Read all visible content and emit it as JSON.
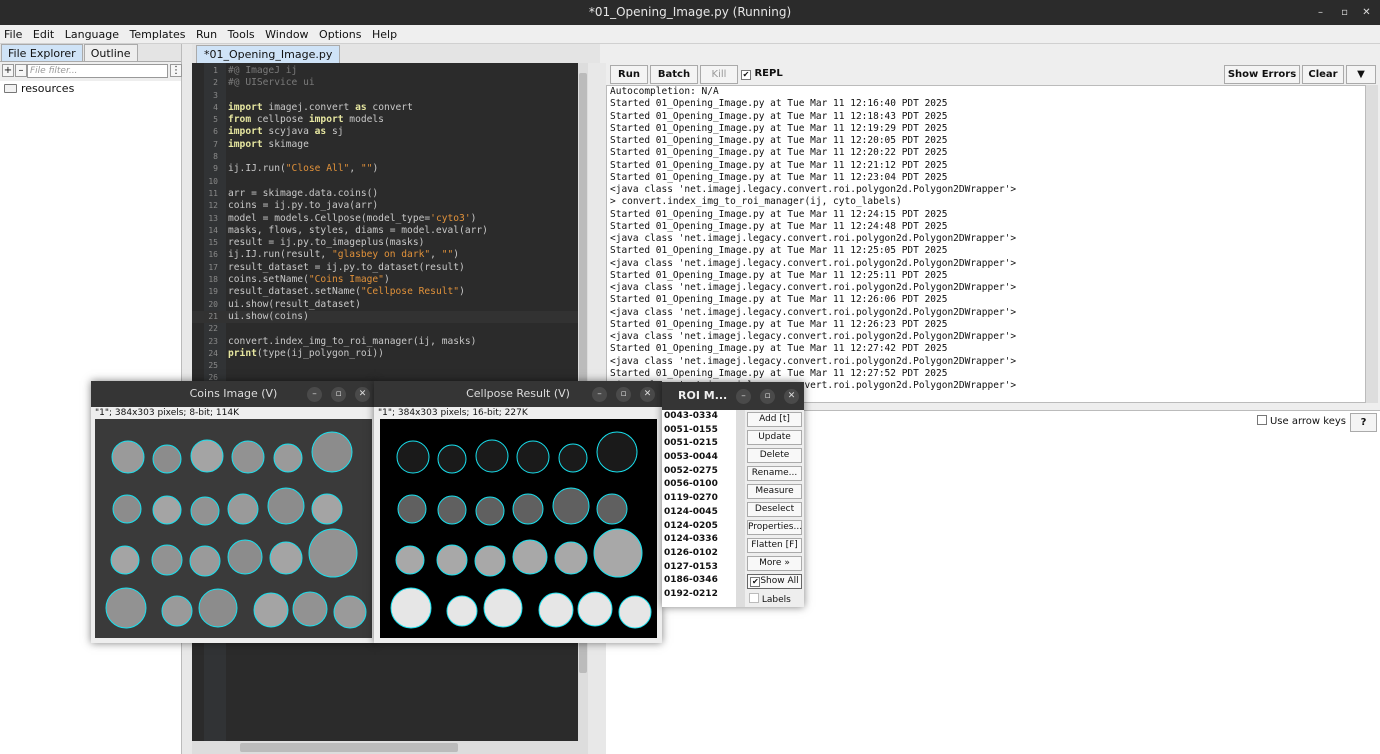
{
  "window": {
    "title": "*01_Opening_Image.py (Running)",
    "controls": [
      "–",
      "▫",
      "✕"
    ]
  },
  "menu": [
    "File",
    "Edit",
    "Language",
    "Templates",
    "Run",
    "Tools",
    "Window",
    "Options",
    "Help"
  ],
  "left_tabs": [
    "File Explorer",
    "Outline"
  ],
  "filter": {
    "placeholder": "File filter...",
    "buttons": [
      "+",
      "–",
      "⋮"
    ]
  },
  "tree": [
    "resources"
  ],
  "editor_tab": "*01_Opening_Image.py",
  "code_lines": [
    [
      {
        "t": "#@ ImageJ ij",
        "c": "cm"
      }
    ],
    [
      {
        "t": "#@ UIService ui",
        "c": "cm"
      }
    ],
    [],
    [
      {
        "t": "import",
        "c": "kw"
      },
      {
        "t": " imagej.convert "
      },
      {
        "t": "as",
        "c": "kw"
      },
      {
        "t": " convert"
      }
    ],
    [
      {
        "t": "from",
        "c": "kw"
      },
      {
        "t": " cellpose "
      },
      {
        "t": "import",
        "c": "kw"
      },
      {
        "t": " models"
      }
    ],
    [
      {
        "t": "import",
        "c": "kw"
      },
      {
        "t": " scyjava "
      },
      {
        "t": "as",
        "c": "kw"
      },
      {
        "t": " sj"
      }
    ],
    [
      {
        "t": "import",
        "c": "kw"
      },
      {
        "t": " skimage"
      }
    ],
    [],
    [
      {
        "t": "ij.IJ.run("
      },
      {
        "t": "\"Close All\"",
        "c": "str"
      },
      {
        "t": ", "
      },
      {
        "t": "\"\"",
        "c": "str"
      },
      {
        "t": ")"
      }
    ],
    [],
    [
      {
        "t": "arr = skimage.data.coins()"
      }
    ],
    [
      {
        "t": "coins = ij.py.to_java(arr)"
      }
    ],
    [
      {
        "t": "model = models.Cellpose(model_type="
      },
      {
        "t": "'cyto3'",
        "c": "str"
      },
      {
        "t": ")"
      }
    ],
    [
      {
        "t": "masks, flows, styles, diams = model.eval(arr)"
      }
    ],
    [
      {
        "t": "result = ij.py.to_imageplus(masks)"
      }
    ],
    [
      {
        "t": "ij.IJ.run(result, "
      },
      {
        "t": "\"glasbey on dark\"",
        "c": "str"
      },
      {
        "t": ", "
      },
      {
        "t": "\"\"",
        "c": "str"
      },
      {
        "t": ")"
      }
    ],
    [
      {
        "t": "result_dataset = ij.py.to_dataset(result)"
      }
    ],
    [
      {
        "t": "coins.setName("
      },
      {
        "t": "\"Coins Image\"",
        "c": "str"
      },
      {
        "t": ")"
      }
    ],
    [
      {
        "t": "result_dataset.setName("
      },
      {
        "t": "\"Cellpose Result\"",
        "c": "str"
      },
      {
        "t": ")"
      }
    ],
    [
      {
        "t": "ui.show(result_dataset)"
      }
    ],
    [
      {
        "t": "ui.show(coins)"
      }
    ],
    [],
    [
      {
        "t": "convert.index_img_to_roi_manager(ij, masks)"
      }
    ],
    [
      {
        "t": "print",
        "c": "kw"
      },
      {
        "t": "(type(ij_polygon_roi))"
      }
    ],
    [],
    []
  ],
  "current_line": 21,
  "toolbar": {
    "run": "Run",
    "batch": "Batch",
    "kill": "Kill",
    "repl": "REPL",
    "show_errors": "Show Errors",
    "clear": "Clear",
    "menu": "▼"
  },
  "console_lines": [
    "Autocompletion: N/A",
    "Started 01_Opening_Image.py at Tue Mar 11 12:16:40 PDT 2025",
    "Started 01_Opening_Image.py at Tue Mar 11 12:18:43 PDT 2025",
    "Started 01_Opening_Image.py at Tue Mar 11 12:19:29 PDT 2025",
    "Started 01_Opening_Image.py at Tue Mar 11 12:20:05 PDT 2025",
    "Started 01_Opening_Image.py at Tue Mar 11 12:20:22 PDT 2025",
    "Started 01_Opening_Image.py at Tue Mar 11 12:21:12 PDT 2025",
    "Started 01_Opening_Image.py at Tue Mar 11 12:23:04 PDT 2025",
    "<java class 'net.imagej.legacy.convert.roi.polygon2d.Polygon2DWrapper'>",
    "> convert.index_img_to_roi_manager(ij, cyto_labels)",
    "Started 01_Opening_Image.py at Tue Mar 11 12:24:15 PDT 2025",
    "Started 01_Opening_Image.py at Tue Mar 11 12:24:48 PDT 2025",
    "<java class 'net.imagej.legacy.convert.roi.polygon2d.Polygon2DWrapper'>",
    "Started 01_Opening_Image.py at Tue Mar 11 12:25:05 PDT 2025",
    "<java class 'net.imagej.legacy.convert.roi.polygon2d.Polygon2DWrapper'>",
    "Started 01_Opening_Image.py at Tue Mar 11 12:25:11 PDT 2025",
    "<java class 'net.imagej.legacy.convert.roi.polygon2d.Polygon2DWrapper'>",
    "Started 01_Opening_Image.py at Tue Mar 11 12:26:06 PDT 2025",
    "<java class 'net.imagej.legacy.convert.roi.polygon2d.Polygon2DWrapper'>",
    "Started 01_Opening_Image.py at Tue Mar 11 12:26:23 PDT 2025",
    "<java class 'net.imagej.legacy.convert.roi.polygon2d.Polygon2DWrapper'>",
    "Started 01_Opening_Image.py at Tue Mar 11 12:27:42 PDT 2025",
    "<java class 'net.imagej.legacy.convert.roi.polygon2d.Polygon2DWrapper'>",
    "Started 01_Opening_Image.py at Tue Mar 11 12:27:52 PDT 2025",
    "<java class 'net.imagej.legacy.convert.roi.polygon2d.Polygon2DWrapper'>"
  ],
  "bottom": {
    "arrow_keys": "Use arrow keys",
    "help": "?"
  },
  "coins_window": {
    "title": "Coins Image (V)",
    "info": "\"1\"; 384x303 pixels; 8-bit; 114K"
  },
  "cellpose_window": {
    "title": "Cellpose Result (V)",
    "info": "\"1\"; 384x303 pixels; 16-bit; 227K"
  },
  "roi_manager": {
    "title": "ROI M...",
    "items": [
      "0043-0334",
      "0051-0155",
      "0051-0215",
      "0053-0044",
      "0052-0275",
      "0056-0100",
      "0119-0270",
      "0124-0045",
      "0124-0205",
      "0124-0336",
      "0126-0102",
      "0127-0153",
      "0186-0346",
      "0192-0212"
    ],
    "buttons": [
      "Add [t]",
      "Update",
      "Delete",
      "Rename...",
      "Measure",
      "Deselect",
      "Properties...",
      "Flatten [F]",
      "More »"
    ],
    "show_all": "Show All",
    "labels": "Labels"
  },
  "colors": {
    "editor_bg": "#2b2b2b",
    "roi_outline": "#18e0ee",
    "keyword": "#e6e6a0",
    "string": "#e0913a",
    "comment": "#7a7a7a",
    "tab_active": "#cfe3f7"
  }
}
